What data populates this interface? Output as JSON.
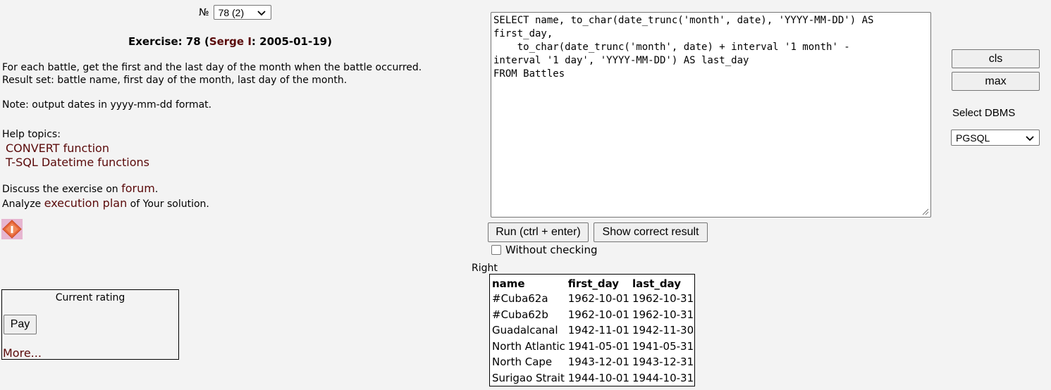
{
  "exercise": {
    "number_label": "№",
    "selected": "78 (2)",
    "title_prefix": "Exercise: 78 (",
    "author": "Serge I",
    "title_suffix": ": 2005-01-19)",
    "task_line1": "For each battle, get the first and the last day of the month when the battle occurred.",
    "task_line2": "Result set: battle name, first day of the month, last day of the month.",
    "note": "Note: output dates in yyyy-mm-dd format.",
    "help_heading": "Help topics:",
    "help_links": [
      "CONVERT function",
      "T-SQL Datetime functions"
    ],
    "discuss_prefix": "Discuss the exercise on ",
    "discuss_link": "forum",
    "discuss_suffix": ".",
    "analyze_prefix": "Analyze ",
    "analyze_link": "execution plan",
    "analyze_suffix": " of Your solution."
  },
  "rating": {
    "title": "Current rating",
    "pay_label": "Pay",
    "more_label": "More..."
  },
  "editor": {
    "sql": "SELECT name, to_char(date_trunc('month', date), 'YYYY-MM-DD') AS\nfirst_day,\n    to_char(date_trunc('month', date) + interval '1 month' -\ninterval '1 day', 'YYYY-MM-DD') AS last_day\nFROM Battles"
  },
  "actions": {
    "run_label": "Run (ctrl + enter)",
    "show_label": "Show correct result",
    "without_checking": "Without checking",
    "status": "Right"
  },
  "result": {
    "columns": [
      "name",
      "first_day",
      "last_day"
    ],
    "rows": [
      [
        "#Cuba62a",
        "1962-10-01",
        "1962-10-31"
      ],
      [
        "#Cuba62b",
        "1962-10-01",
        "1962-10-31"
      ],
      [
        "Guadalcanal",
        "1942-11-01",
        "1942-11-30"
      ],
      [
        "North Atlantic",
        "1941-05-01",
        "1941-05-31"
      ],
      [
        "North Cape",
        "1943-12-01",
        "1943-12-31"
      ],
      [
        "Surigao Strait",
        "1944-10-01",
        "1944-10-31"
      ]
    ]
  },
  "side": {
    "cls_label": "cls",
    "max_label": "max",
    "dbms_label": "Select DBMS",
    "dbms_selected": "PGSQL"
  },
  "colors": {
    "link": "#5a0a0a",
    "background": "#f3f3f3"
  }
}
